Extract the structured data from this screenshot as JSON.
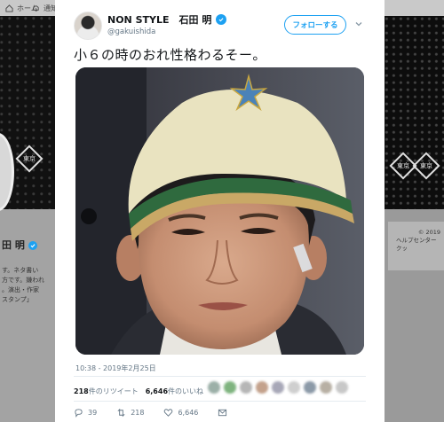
{
  "background": {
    "nav_items": [
      "ホーム",
      "通知"
    ],
    "profile_name": "田 明",
    "bio_lines": [
      "す。ネタ書い",
      "方です。嫌われ",
      "。演出・作家",
      "スタンプ」"
    ],
    "right_card_lines": [
      "© 2019",
      "ヘルプセンター",
      "クッ"
    ],
    "sign_text": "東京"
  },
  "tweet": {
    "display_name": "NON STYLE　石田 明",
    "handle": "@gakuishida",
    "follow_label": "フォローする",
    "text": "小６の時のおれ性格わるそー。",
    "timestamp": "10:38 - 2019年2月25日",
    "retweets_count": "218",
    "retweets_label": "件のリツイート",
    "likes_count": "6,646",
    "likes_label": "件のいいね",
    "actions": {
      "replies": "39",
      "retweets": "218",
      "likes": "6,646"
    }
  },
  "colors": {
    "accent": "#1da1f2",
    "secondary_text": "#657786",
    "primary_text": "#14171a"
  }
}
